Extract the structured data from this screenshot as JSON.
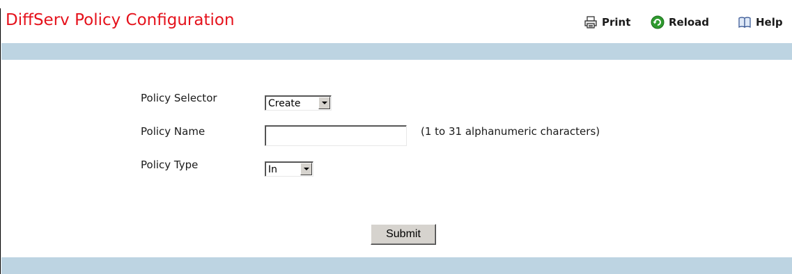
{
  "header": {
    "title": "DiffServ Policy Configuration",
    "title_color": "#e5121c",
    "toolbar": {
      "print": {
        "label": "Print",
        "icon": "printer-icon"
      },
      "reload": {
        "label": "Reload",
        "icon": "reload-icon",
        "icon_color": "#2e9a2e"
      },
      "help": {
        "label": "Help",
        "icon": "book-icon"
      }
    }
  },
  "band_color": "#bdd4e2",
  "form": {
    "policy_selector": {
      "label": "Policy Selector",
      "value": "Create"
    },
    "policy_name": {
      "label": "Policy Name",
      "value": "",
      "hint": "(1 to 31 alphanumeric characters)"
    },
    "policy_type": {
      "label": "Policy Type",
      "value": "In"
    },
    "submit_label": "Submit"
  }
}
